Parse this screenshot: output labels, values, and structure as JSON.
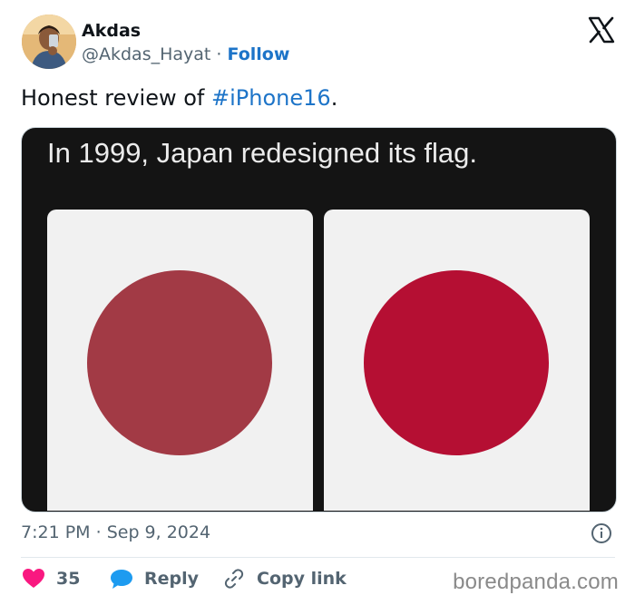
{
  "author": {
    "name": "Akdas",
    "handle": "@Akdas_Hayat",
    "separator": "·",
    "follow_label": "Follow"
  },
  "tweet": {
    "text_prefix": "Honest review of ",
    "hashtag": "#iPhone16",
    "text_suffix": "."
  },
  "media": {
    "caption": "In 1999, Japan redesigned its flag.",
    "colors": {
      "left_disc": "#a23a45",
      "right_disc": "#b50f33",
      "flag_field": "#f1f1f1",
      "background": "#141414"
    }
  },
  "meta": {
    "time": "7:21 PM",
    "separator": "·",
    "date": "Sep 9, 2024"
  },
  "actions": {
    "likes_count": "35",
    "reply_label": "Reply",
    "copy_link_label": "Copy link"
  },
  "watermark": "boredpanda.com",
  "icons": [
    "avatar",
    "x-logo-icon",
    "info-icon",
    "heart-icon",
    "reply-bubble-icon",
    "link-icon"
  ],
  "accent": {
    "link": "#1d74c8",
    "heart": "#f91880",
    "reply": "#1d9bf0",
    "muted": "#536471"
  }
}
